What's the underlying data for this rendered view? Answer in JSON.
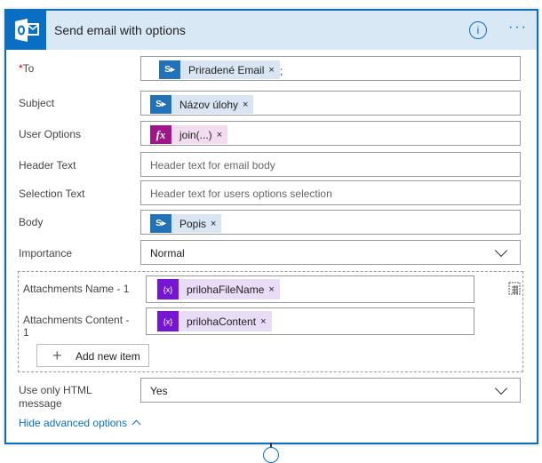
{
  "header": {
    "title": "Send email with options",
    "info_icon": "i",
    "more_icon": "···"
  },
  "fields": {
    "to": {
      "label": "To",
      "required_mark": "*",
      "token": "Priradené Email",
      "separator": ";"
    },
    "subject": {
      "label": "Subject",
      "token": "Názov úlohy"
    },
    "user_options": {
      "label": "User Options",
      "token": "join(...)",
      "token_icon": "fx"
    },
    "header_text": {
      "label": "Header Text",
      "placeholder": "Header text for email body"
    },
    "selection_text": {
      "label": "Selection Text",
      "placeholder": "Header text for users options selection"
    },
    "body": {
      "label": "Body",
      "token": "Popis"
    },
    "importance": {
      "label": "Importance",
      "value": "Normal"
    },
    "attachments": {
      "name_label": "Attachments Name - 1",
      "name_token": "prilohaFileName",
      "content_label": "Attachments Content - 1",
      "content_token": "prilohaContent",
      "var_icon": "{x}",
      "add_label": "Add new item"
    },
    "html_only": {
      "label": "Use only HTML message",
      "value": "Yes"
    }
  },
  "hide_advanced": "Hide advanced options",
  "token_close": "×"
}
